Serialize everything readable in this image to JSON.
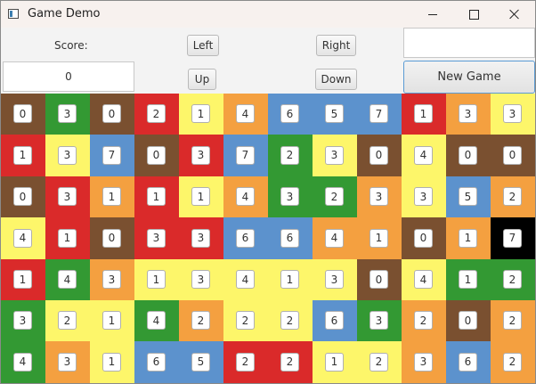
{
  "window": {
    "title": "Game Demo"
  },
  "controls": {
    "score_label": "Score:",
    "score_value": "0",
    "name_value": "",
    "left_label": "Left",
    "right_label": "Right",
    "up_label": "Up",
    "down_label": "Down",
    "new_game_label": "New Game"
  },
  "colors": {
    "brown": "#7a5030",
    "green": "#339933",
    "yellow": "#fdf66a",
    "red": "#da2a2a",
    "orange": "#f4a040",
    "blue": "#5c92cd",
    "black": "#000000"
  },
  "board": {
    "rows": [
      [
        {
          "v": "0",
          "c": "brown"
        },
        {
          "v": "3",
          "c": "green"
        },
        {
          "v": "0",
          "c": "brown"
        },
        {
          "v": "2",
          "c": "red"
        },
        {
          "v": "1",
          "c": "yellow"
        },
        {
          "v": "4",
          "c": "orange"
        },
        {
          "v": "6",
          "c": "blue"
        },
        {
          "v": "5",
          "c": "blue"
        },
        {
          "v": "7",
          "c": "blue"
        },
        {
          "v": "1",
          "c": "red"
        },
        {
          "v": "3",
          "c": "orange"
        },
        {
          "v": "3",
          "c": "yellow"
        }
      ],
      [
        {
          "v": "1",
          "c": "red"
        },
        {
          "v": "3",
          "c": "yellow"
        },
        {
          "v": "7",
          "c": "blue"
        },
        {
          "v": "0",
          "c": "brown"
        },
        {
          "v": "3",
          "c": "red"
        },
        {
          "v": "7",
          "c": "blue"
        },
        {
          "v": "2",
          "c": "green"
        },
        {
          "v": "3",
          "c": "yellow"
        },
        {
          "v": "0",
          "c": "brown"
        },
        {
          "v": "4",
          "c": "yellow"
        },
        {
          "v": "0",
          "c": "brown"
        },
        {
          "v": "0",
          "c": "brown"
        }
      ],
      [
        {
          "v": "0",
          "c": "brown"
        },
        {
          "v": "3",
          "c": "red"
        },
        {
          "v": "1",
          "c": "orange"
        },
        {
          "v": "1",
          "c": "red"
        },
        {
          "v": "1",
          "c": "yellow"
        },
        {
          "v": "4",
          "c": "orange"
        },
        {
          "v": "3",
          "c": "green"
        },
        {
          "v": "2",
          "c": "green"
        },
        {
          "v": "3",
          "c": "orange"
        },
        {
          "v": "3",
          "c": "yellow"
        },
        {
          "v": "5",
          "c": "blue"
        },
        {
          "v": "2",
          "c": "orange"
        }
      ],
      [
        {
          "v": "4",
          "c": "yellow"
        },
        {
          "v": "1",
          "c": "red"
        },
        {
          "v": "0",
          "c": "brown"
        },
        {
          "v": "3",
          "c": "red"
        },
        {
          "v": "3",
          "c": "red"
        },
        {
          "v": "6",
          "c": "blue"
        },
        {
          "v": "6",
          "c": "blue"
        },
        {
          "v": "4",
          "c": "orange"
        },
        {
          "v": "1",
          "c": "orange"
        },
        {
          "v": "0",
          "c": "brown"
        },
        {
          "v": "1",
          "c": "orange"
        },
        {
          "v": "7",
          "c": "black"
        }
      ],
      [
        {
          "v": "1",
          "c": "red"
        },
        {
          "v": "4",
          "c": "green"
        },
        {
          "v": "3",
          "c": "orange"
        },
        {
          "v": "1",
          "c": "yellow"
        },
        {
          "v": "3",
          "c": "yellow"
        },
        {
          "v": "4",
          "c": "yellow"
        },
        {
          "v": "1",
          "c": "yellow"
        },
        {
          "v": "3",
          "c": "yellow"
        },
        {
          "v": "0",
          "c": "brown"
        },
        {
          "v": "4",
          "c": "yellow"
        },
        {
          "v": "1",
          "c": "green"
        },
        {
          "v": "2",
          "c": "green"
        }
      ],
      [
        {
          "v": "3",
          "c": "green"
        },
        {
          "v": "2",
          "c": "yellow"
        },
        {
          "v": "1",
          "c": "yellow"
        },
        {
          "v": "4",
          "c": "green"
        },
        {
          "v": "2",
          "c": "orange"
        },
        {
          "v": "2",
          "c": "yellow"
        },
        {
          "v": "2",
          "c": "yellow"
        },
        {
          "v": "6",
          "c": "blue"
        },
        {
          "v": "3",
          "c": "green"
        },
        {
          "v": "2",
          "c": "orange"
        },
        {
          "v": "0",
          "c": "brown"
        },
        {
          "v": "2",
          "c": "orange"
        }
      ],
      [
        {
          "v": "4",
          "c": "green"
        },
        {
          "v": "3",
          "c": "orange"
        },
        {
          "v": "1",
          "c": "yellow"
        },
        {
          "v": "6",
          "c": "blue"
        },
        {
          "v": "5",
          "c": "blue"
        },
        {
          "v": "2",
          "c": "red"
        },
        {
          "v": "2",
          "c": "red"
        },
        {
          "v": "1",
          "c": "yellow"
        },
        {
          "v": "2",
          "c": "yellow"
        },
        {
          "v": "3",
          "c": "orange"
        },
        {
          "v": "6",
          "c": "blue"
        },
        {
          "v": "2",
          "c": "orange"
        }
      ]
    ]
  }
}
